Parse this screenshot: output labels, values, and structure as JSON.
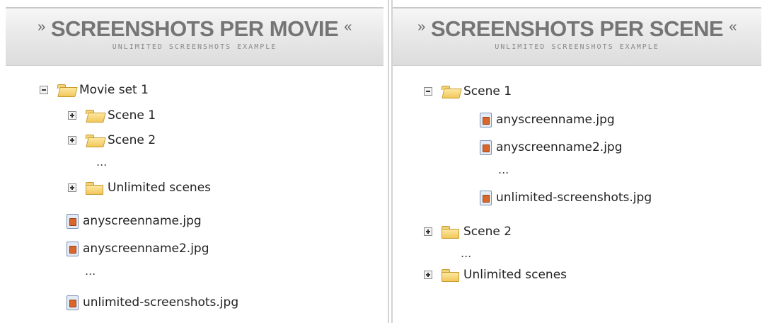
{
  "left_panel": {
    "header": {
      "arrow_left": "»",
      "title": "SCREENSHOTS PER MOVIE",
      "arrow_right": "«",
      "subtitle": "UNLIMITED SCREENSHOTS EXAMPLE"
    },
    "tree": {
      "root": "Movie set 1",
      "folders": [
        "Scene 1",
        "Scene 2"
      ],
      "ellipsis_1": "...",
      "extra_folder": "Unlimited scenes",
      "files": [
        "anyscreenname.jpg",
        "anyscreenname2.jpg"
      ],
      "ellipsis_2": "...",
      "last_file": "unlimited-screenshots.jpg"
    }
  },
  "right_panel": {
    "header": {
      "arrow_left": "»",
      "title": "SCREENSHOTS PER SCENE",
      "arrow_right": "«",
      "subtitle": "UNLIMITED SCREENSHOTS EXAMPLE"
    },
    "tree": {
      "root": "Scene 1",
      "files": [
        "anyscreenname.jpg",
        "anyscreenname2.jpg"
      ],
      "ellipsis_1": "...",
      "last_file": "unlimited-screenshots.jpg",
      "folder_2": "Scene 2",
      "ellipsis_2": "...",
      "folder_3": "Unlimited scenes"
    }
  }
}
